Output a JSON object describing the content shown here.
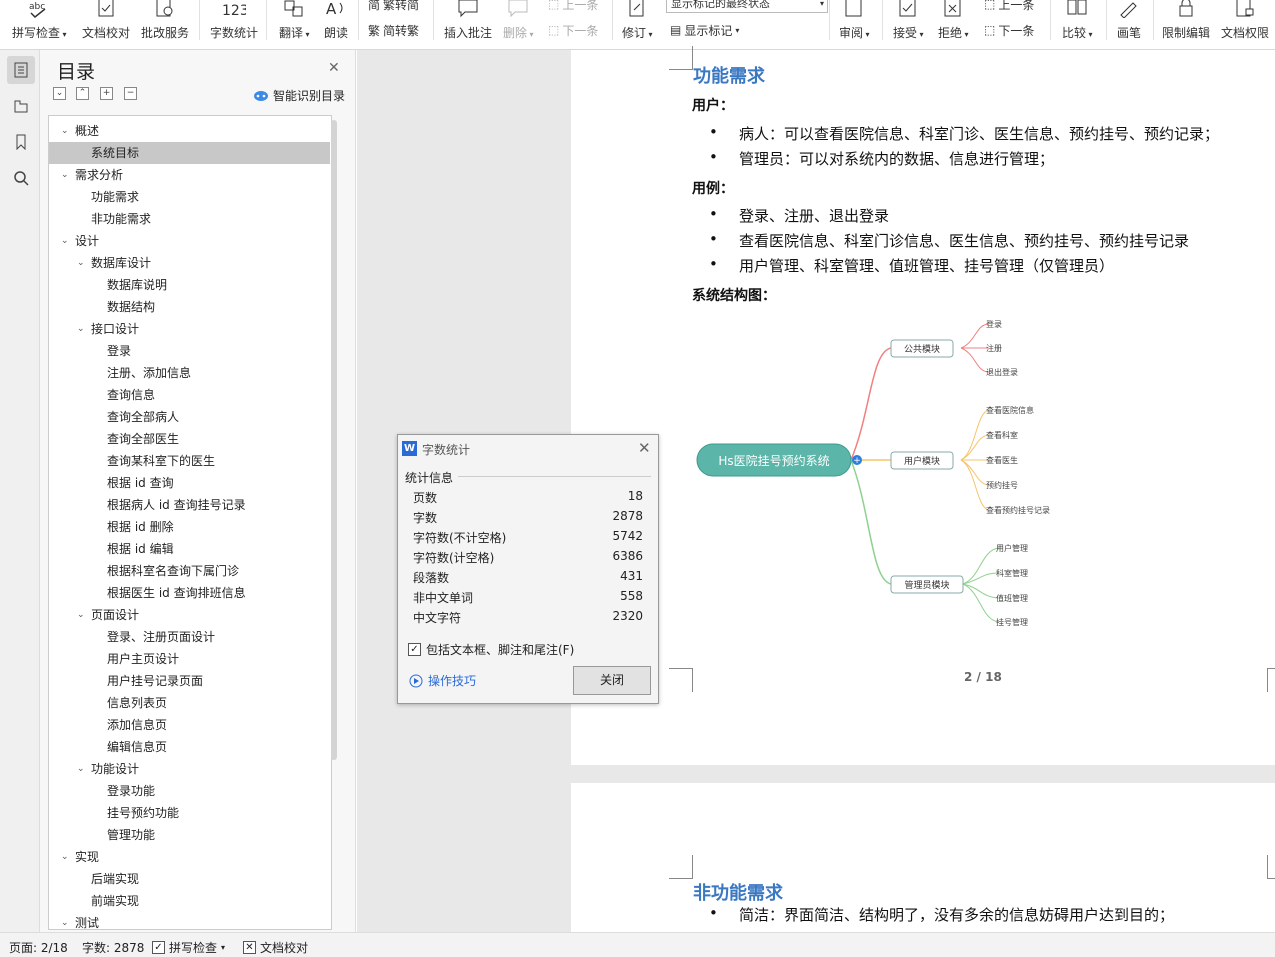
{
  "ribbon": {
    "spellcheck": "拼写检查",
    "doc_proof": "文档校对",
    "revise_service": "批改服务",
    "word_count": "字数统计",
    "translate": "翻译",
    "read_aloud": "朗读",
    "trad_to_simp": "繁转简",
    "simp_to_trad": "简转繁",
    "insert_comment": "插入批注",
    "delete": "删除",
    "prev": "上一条",
    "next": "下一条",
    "track_changes": "修订",
    "markup_select": "显示标记的最终状态",
    "show_markup": "显示标记",
    "review": "审阅",
    "accept": "接受",
    "reject": "拒绝",
    "next2": "下一条",
    "prev2": "上一条",
    "compare": "比较",
    "pen": "画笔",
    "restrict_edit": "限制编辑",
    "doc_permission": "文档权限"
  },
  "nav": {
    "title": "目录",
    "ai_toc": "智能识别目录",
    "items": [
      {
        "label": "概述",
        "level": 0,
        "expanded": true
      },
      {
        "label": "系统目标",
        "level": 1,
        "selected": true
      },
      {
        "label": "需求分析",
        "level": 0,
        "expanded": true
      },
      {
        "label": "功能需求",
        "level": 1
      },
      {
        "label": "非功能需求",
        "level": 1
      },
      {
        "label": "设计",
        "level": 0,
        "expanded": true
      },
      {
        "label": "数据库设计",
        "level": 1,
        "expanded": true
      },
      {
        "label": "数据库说明",
        "level": 2
      },
      {
        "label": "数据结构",
        "level": 2
      },
      {
        "label": "接口设计",
        "level": 1,
        "expanded": true
      },
      {
        "label": "登录",
        "level": 2
      },
      {
        "label": "注册、添加信息",
        "level": 2
      },
      {
        "label": "查询信息",
        "level": 2
      },
      {
        "label": "查询全部病人",
        "level": 2
      },
      {
        "label": "查询全部医生",
        "level": 2
      },
      {
        "label": "查询某科室下的医生",
        "level": 2
      },
      {
        "label": "根据 id 查询",
        "level": 2
      },
      {
        "label": "根据病人 id 查询挂号记录",
        "level": 2
      },
      {
        "label": "根据 id 删除",
        "level": 2
      },
      {
        "label": "根据 id 编辑",
        "level": 2
      },
      {
        "label": "根据科室名查询下属门诊",
        "level": 2
      },
      {
        "label": "根据医生 id 查询排班信息",
        "level": 2
      },
      {
        "label": "页面设计",
        "level": 1,
        "expanded": true
      },
      {
        "label": "登录、注册页面设计",
        "level": 2
      },
      {
        "label": "用户主页设计",
        "level": 2
      },
      {
        "label": "用户挂号记录页面",
        "level": 2
      },
      {
        "label": "信息列表页",
        "level": 2
      },
      {
        "label": "添加信息页",
        "level": 2
      },
      {
        "label": "编辑信息页",
        "level": 2
      },
      {
        "label": "功能设计",
        "level": 1,
        "expanded": true
      },
      {
        "label": "登录功能",
        "level": 2
      },
      {
        "label": "挂号预约功能",
        "level": 2
      },
      {
        "label": "管理功能",
        "level": 2
      },
      {
        "label": "实现",
        "level": 0,
        "expanded": true
      },
      {
        "label": "后端实现",
        "level": 1
      },
      {
        "label": "前端实现",
        "level": 1
      },
      {
        "label": "测试",
        "level": 0,
        "expanded": true
      }
    ]
  },
  "document": {
    "heading_func": "功能需求",
    "users_title": "用户：",
    "users": [
      "病人：可以查看医院信息、科室门诊、医生信息、预约挂号、预约记录；",
      "管理员：可以对系统内的数据、信息进行管理；"
    ],
    "usecase_title": "用例：",
    "usecases": [
      "登录、注册、退出登录",
      "查看医院信息、科室门诊信息、医生信息、预约挂号、预约挂号记录",
      "用户管理、科室管理、值班管理、挂号管理（仅管理员）"
    ],
    "structure_title": "系统结构图：",
    "page_number": "2 / 18",
    "heading_nonfunc": "非功能需求",
    "nonfunc_bullet": "简洁：界面简洁、结构明了，没有多余的信息妨碍用户达到目的；"
  },
  "mindmap": {
    "root": "Hs医院挂号预约系统",
    "branches": [
      {
        "name": "公共模块",
        "color": "#f08080",
        "children": [
          "登录",
          "注册",
          "退出登录"
        ]
      },
      {
        "name": "用户模块",
        "color": "#f5c46a",
        "children": [
          "查看医院信息",
          "查看科室",
          "查看医生",
          "预约挂号",
          "查看预约挂号记录"
        ]
      },
      {
        "name": "管理员模块",
        "color": "#8fd18f",
        "children": [
          "用户管理",
          "科室管理",
          "值班管理",
          "挂号管理"
        ]
      }
    ],
    "root_color": "#5bb5a8"
  },
  "dialog": {
    "title": "字数统计",
    "section": "统计信息",
    "stats": [
      {
        "label": "页数",
        "value": "18"
      },
      {
        "label": "字数",
        "value": "2878"
      },
      {
        "label": "字符数(不计空格)",
        "value": "5742"
      },
      {
        "label": "字符数(计空格)",
        "value": "6386"
      },
      {
        "label": "段落数",
        "value": "431"
      },
      {
        "label": "非中文单词",
        "value": "558"
      },
      {
        "label": "中文字符",
        "value": "2320"
      }
    ],
    "checkbox_label": "包括文本框、脚注和尾注(F)",
    "checkbox_checked": true,
    "tips": "操作技巧",
    "close": "关闭"
  },
  "status": {
    "page": "页面: 2/18",
    "words": "字数: 2878",
    "spell": "拼写检查",
    "proof": "文档校对"
  }
}
